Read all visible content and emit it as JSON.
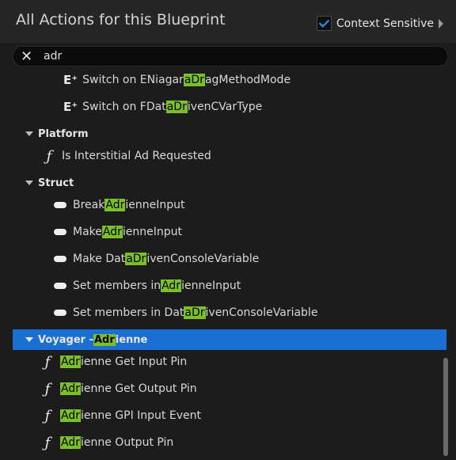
{
  "header": {
    "title": "All Actions for this Blueprint",
    "context_label": "Context Sensitive"
  },
  "search": {
    "query": "adr"
  },
  "rows": [
    {
      "kind": "item",
      "icon": "switch",
      "pre": "Switch on ENiagar",
      "hl": "aDr",
      "post": "agMethodMode"
    },
    {
      "kind": "item",
      "icon": "switch",
      "pre": "Switch on FDat",
      "hl": "aDr",
      "post": "ivenCVarType"
    },
    {
      "kind": "category",
      "label": "Platform"
    },
    {
      "kind": "item",
      "icon": "function",
      "pre": "Is Interstitial Ad Requested",
      "hl": "",
      "post": ""
    },
    {
      "kind": "category",
      "label": "Struct"
    },
    {
      "kind": "item",
      "icon": "struct",
      "pre": "Break ",
      "hl": "Adr",
      "post": "ienneInput"
    },
    {
      "kind": "item",
      "icon": "struct",
      "pre": "Make ",
      "hl": "Adr",
      "post": "ienneInput"
    },
    {
      "kind": "item",
      "icon": "struct",
      "pre": "Make Dat",
      "hl": "aDr",
      "post": "ivenConsoleVariable"
    },
    {
      "kind": "item",
      "icon": "struct",
      "pre": "Set members in ",
      "hl": "Adr",
      "post": "ienneInput"
    },
    {
      "kind": "item",
      "icon": "struct",
      "pre": "Set members in Dat",
      "hl": "aDr",
      "post": "ivenConsoleVariable"
    },
    {
      "kind": "category",
      "pre": "Voyager - ",
      "hl": "Adr",
      "post": "ienne",
      "selected": true
    },
    {
      "kind": "item",
      "icon": "function",
      "pre": "",
      "hl": "Adr",
      "post": "ienne Get Input Pin"
    },
    {
      "kind": "item",
      "icon": "function",
      "pre": "",
      "hl": "Adr",
      "post": "ienne Get Output Pin"
    },
    {
      "kind": "item",
      "icon": "function",
      "pre": "",
      "hl": "Adr",
      "post": "ienne GPI Input Event"
    },
    {
      "kind": "item",
      "icon": "function",
      "pre": "",
      "hl": "Adr",
      "post": "ienne Output Pin"
    }
  ]
}
